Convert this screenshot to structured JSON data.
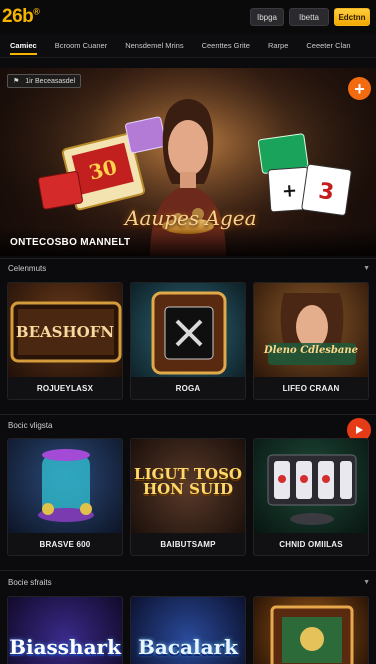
{
  "header": {
    "logo": "26b",
    "logo_mark": "®",
    "btn1": "Ibpga",
    "btn2": "Ibetta",
    "btn3": "Edctnn"
  },
  "nav": {
    "items": [
      "Camiec",
      "Bcroom Cuaner",
      "Nensdemel Mrins",
      "Ceenttes Grite",
      "Rarpe",
      "Ceeeter Clan"
    ]
  },
  "hero": {
    "badge_icon": "flag-icon",
    "badge_text": "1ir Beceasasdel",
    "title_art": "Aaupes Agea",
    "caption": "ONTECOSBO MANNELT"
  },
  "sections": [
    {
      "title": "Celenmuts",
      "cards": [
        {
          "art": "BEASHOFN",
          "label": "ROJUEYLASX"
        },
        {
          "art": "",
          "label": "ROGA"
        },
        {
          "art": "Dleno Cdlesbane",
          "label": "LIFEO CRAAN"
        }
      ]
    },
    {
      "title": "Bocic vligsta",
      "cards": [
        {
          "art": "",
          "label": "BRASVE 600"
        },
        {
          "art": "LIGUT TOSO HON SUID",
          "label": "BAIBUTSAMP"
        },
        {
          "art": "",
          "label": "CHNID OMIILAS"
        }
      ]
    },
    {
      "title": "Bocie sfraits",
      "cards": [
        {
          "art": "Biasshark",
          "label": ""
        },
        {
          "art": "Bacalark",
          "label": ""
        },
        {
          "art": "",
          "label": ""
        }
      ]
    }
  ],
  "colors": {
    "accent": "#f5b400",
    "fab": "#f36a10",
    "play": "#e53b17"
  }
}
